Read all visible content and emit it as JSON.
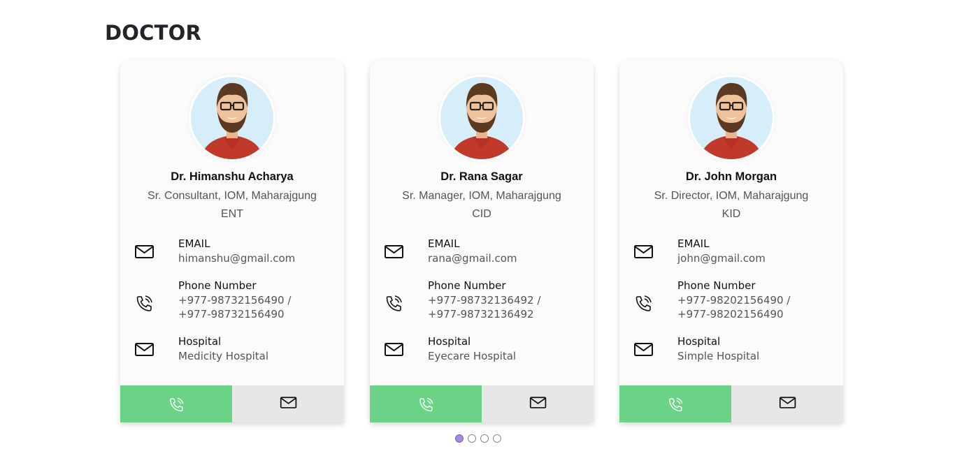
{
  "page": {
    "title": "DOCTOR"
  },
  "colors": {
    "call_button": "#6ad386",
    "mail_button": "#e7e7e7",
    "active_dot": "#a58ae0"
  },
  "icons": {
    "email": "envelope-icon",
    "phone": "phone-icon",
    "hospital": "envelope-icon",
    "call_button": "phone-icon",
    "mail_button": "envelope-icon"
  },
  "doctors": [
    {
      "name": "Dr. Himanshu Acharya",
      "role": "Sr. Consultant, IOM, Maharajgung",
      "department": "ENT",
      "email_label": "EMAIL",
      "email": "himanshu@gmail.com",
      "phone_label": "Phone Number",
      "phone_line1": "+977-98732156490 /",
      "phone_line2": "+977-98732156490",
      "hospital_label": "Hospital",
      "hospital": "Medicity Hospital"
    },
    {
      "name": "Dr. Rana Sagar",
      "role": "Sr. Manager, IOM, Maharajgung",
      "department": "CID",
      "email_label": "EMAIL",
      "email": "rana@gmail.com",
      "phone_label": "Phone Number",
      "phone_line1": "+977-98732136492 /",
      "phone_line2": "+977-98732136492",
      "hospital_label": "Hospital",
      "hospital": "Eyecare Hospital"
    },
    {
      "name": "Dr. John Morgan",
      "role": "Sr. Director, IOM, Maharajgung",
      "department": "KID",
      "email_label": "EMAIL",
      "email": "john@gmail.com",
      "phone_label": "Phone Number",
      "phone_line1": "+977-98202156490 /",
      "phone_line2": "+977-98202156490",
      "hospital_label": "Hospital",
      "hospital": "Simple Hospital"
    }
  ],
  "pagination": {
    "total": 4,
    "active": 1
  }
}
